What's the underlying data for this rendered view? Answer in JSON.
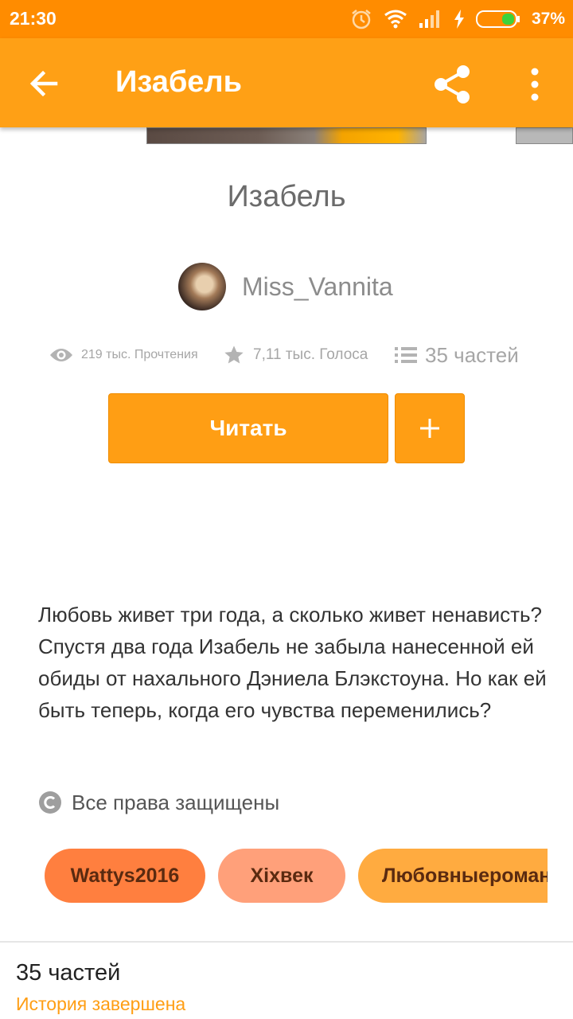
{
  "status_bar": {
    "time": "21:30",
    "battery": "37%"
  },
  "app_bar": {
    "title": "Изабель"
  },
  "story": {
    "title": "Изабель",
    "author": "Miss_Vannita",
    "reads": "219 тыс. Прочтения",
    "votes": "7,11 тыс. Голоса",
    "parts": "35 частей",
    "read_button": "Читать",
    "add_button": "+",
    "description": "Любовь живет три года, а сколько живет ненависть? Спустя два года Изабель не забыла нанесенной ей обиды от нахального Дэниела Блэкстоуна. Но как ей быть теперь, когда его чувства переменились?",
    "copyright": "Все права защищены",
    "tags": [
      "Wattys2016",
      "Xixвек",
      "Любовныероман"
    ],
    "parts_count": "35 частей",
    "completion": "История завершена"
  },
  "colors": {
    "status_bar": "#ff8c00",
    "app_bar": "#ffa015",
    "accent": "#ff9e14"
  }
}
